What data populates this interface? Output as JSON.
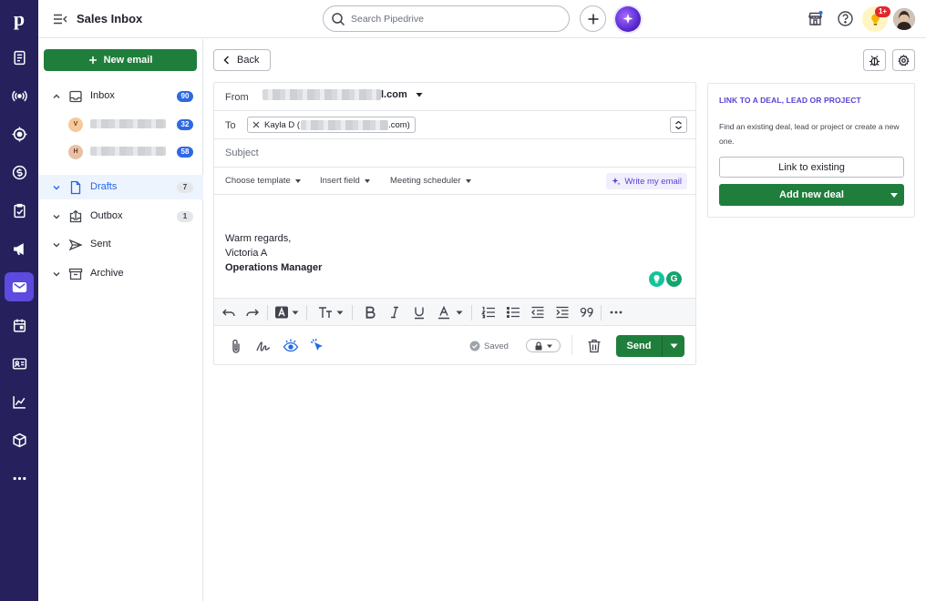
{
  "app": {
    "title": "Sales Inbox"
  },
  "search": {
    "placeholder": "Search Pipedrive"
  },
  "rail": {
    "logo": "p",
    "items": [
      {
        "icon": "leads-icon"
      },
      {
        "icon": "campaigns-icon"
      },
      {
        "icon": "deals-icon"
      },
      {
        "icon": "dollar-icon"
      },
      {
        "icon": "activities-icon"
      },
      {
        "icon": "megaphone-icon"
      },
      {
        "icon": "mail-icon",
        "active": true
      },
      {
        "icon": "calendar-icon"
      },
      {
        "icon": "contacts-icon"
      },
      {
        "icon": "insights-icon"
      },
      {
        "icon": "products-icon"
      },
      {
        "icon": "more-icon"
      }
    ]
  },
  "header": {
    "tips_badge": "1+"
  },
  "sidebar": {
    "new_email_label": "New email",
    "folders": [
      {
        "label": "Inbox",
        "count": "90",
        "count_style": "blue"
      },
      {
        "label": "Drafts",
        "count": "7",
        "count_style": "grey",
        "active": true
      },
      {
        "label": "Outbox",
        "count": "1",
        "count_style": "grey"
      },
      {
        "label": "Sent",
        "count": ""
      },
      {
        "label": "Archive",
        "count": ""
      }
    ],
    "accounts": [
      {
        "initial": "V",
        "count": "32",
        "color": "#f6c89b"
      },
      {
        "initial": "H",
        "count": "58",
        "color": "#e8c0a8"
      }
    ]
  },
  "toolbar": {
    "back_label": "Back"
  },
  "composer": {
    "from_label": "From",
    "from_value_visible": "l.com",
    "to_label": "To",
    "to_chip_start": "Kayla D (",
    "to_chip_end": ".com)",
    "subject_placeholder": "Subject",
    "template_label": "Choose template",
    "insert_field_label": "Insert field",
    "meeting_label": "Meeting scheduler",
    "write_label": "Write my email",
    "signature": {
      "line1": "Warm regards,",
      "line2": "Victoria A",
      "line3": "Operations Manager"
    },
    "saved_label": "Saved",
    "send_label": "Send"
  },
  "link_panel": {
    "title": "LINK TO A DEAL, LEAD OR PROJECT",
    "description": "Find an existing deal, lead or project or create a new one.",
    "link_existing_label": "Link to existing",
    "add_deal_label": "Add new deal"
  },
  "colors": {
    "rail_bg": "#26215c",
    "accent_green": "#1f7e3c",
    "accent_purple": "#5a3fd6",
    "badge_blue": "#2f68e3"
  }
}
